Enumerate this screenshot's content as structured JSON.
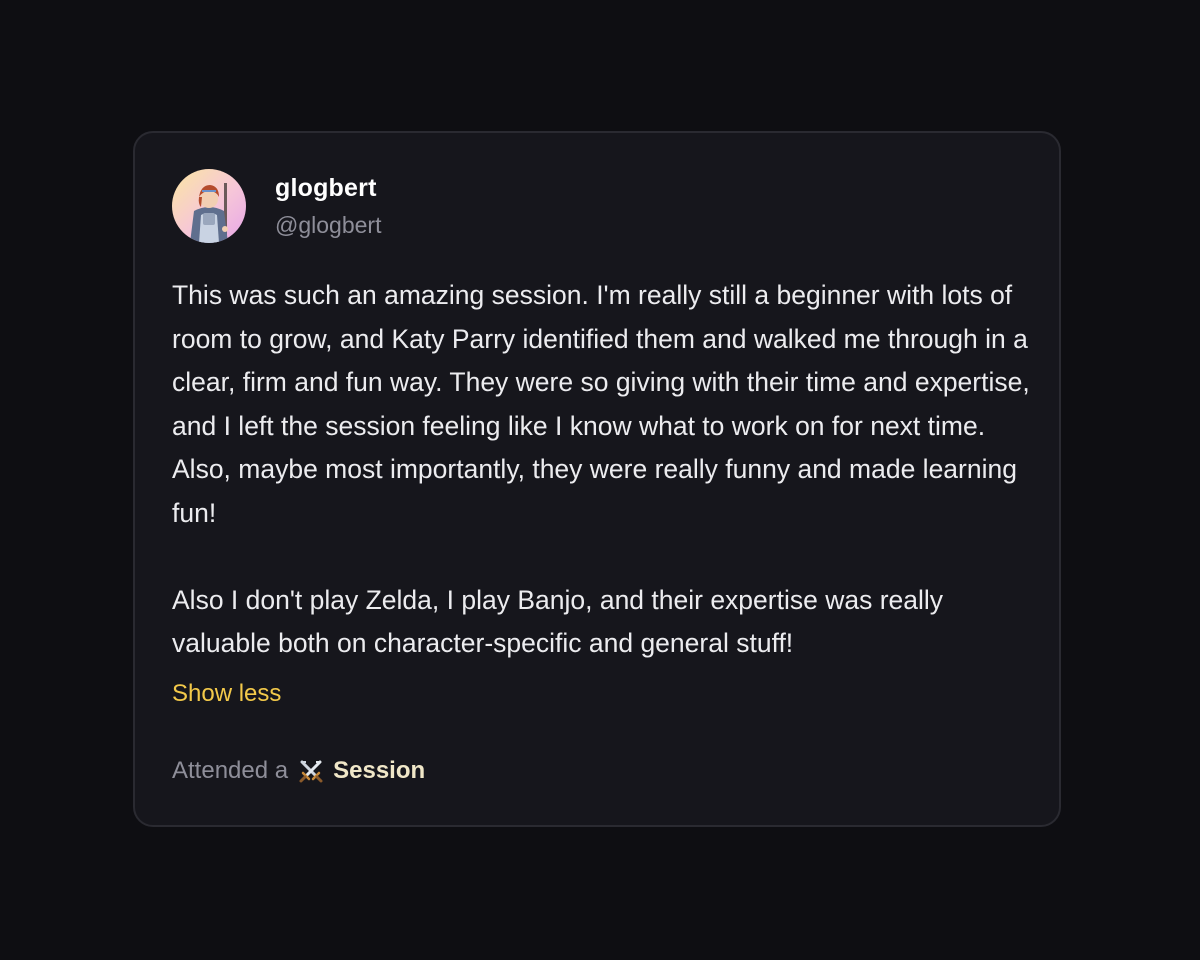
{
  "review": {
    "display_name": "glogbert",
    "handle": "@glogbert",
    "avatar_icon": "user-avatar",
    "paragraphs": [
      "This was such an amazing session. I'm really still a beginner with lots of room to grow, and Katy Parry identified them and walked me through in a clear, firm and fun way. They were so giving with their time and expertise, and I left the session feeling like I know what to work on for next time. Also, maybe most importantly, they were really funny and made learning fun!",
      "Also I don't play Zelda, I play Banjo, and their expertise was really valuable both on character-specific and general stuff!"
    ],
    "show_less_label": "Show less",
    "attended_label": "Attended a",
    "session_icon": "crossed-swords-icon",
    "session_label": "Session"
  },
  "colors": {
    "background": "#0e0e12",
    "card": "#16161c",
    "card_border": "#2a2a31",
    "accent": "#f3c94a",
    "muted": "#8e8e99",
    "text": "#ececef"
  }
}
